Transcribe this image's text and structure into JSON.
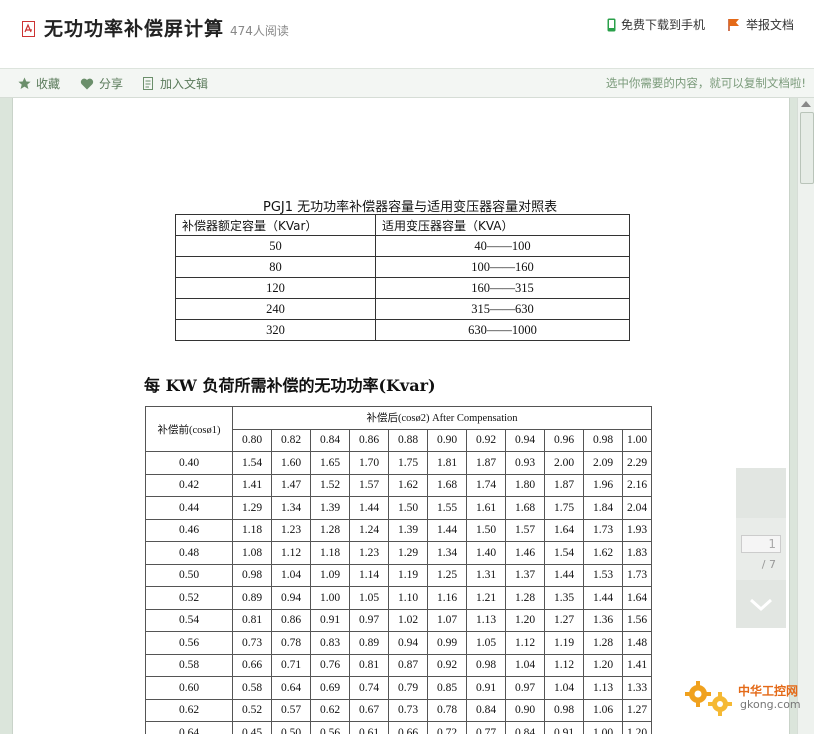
{
  "header": {
    "title": "无功功率补偿屏计算",
    "read_count": "474人阅读",
    "download_label": "免费下载到手机",
    "report_label": "举报文档"
  },
  "toolbar": {
    "favorite_label": "收藏",
    "share_label": "分享",
    "add_label": "加入文辑",
    "hint": "选中你需要的内容，就可以复制文档啦!"
  },
  "table1": {
    "caption": "PGJ1 无功功率补偿器容量与适用变压器容量对照表",
    "headers": [
      "补偿器额定容量（KVar）",
      "适用变压器容量（KVA）"
    ],
    "rows": [
      [
        "50",
        "40——100"
      ],
      [
        "80",
        "100——160"
      ],
      [
        "120",
        "160——315"
      ],
      [
        "240",
        "315——630"
      ],
      [
        "320",
        "630——1000"
      ]
    ]
  },
  "table2": {
    "heading": "每 KW 负荷所需补偿的无功功率(Kvar)",
    "row_header": "补偿前(cosø1)",
    "col_group_header": "补偿后(cosø2) After Compensation",
    "columns": [
      "0.80",
      "0.82",
      "0.84",
      "0.86",
      "0.88",
      "0.90",
      "0.92",
      "0.94",
      "0.96",
      "0.98",
      "1.00"
    ],
    "rows": [
      {
        "label": "0.40",
        "values": [
          "1.54",
          "1.60",
          "1.65",
          "1.70",
          "1.75",
          "1.81",
          "1.87",
          "0.93",
          "2.00",
          "2.09",
          "2.29"
        ]
      },
      {
        "label": "0.42",
        "values": [
          "1.41",
          "1.47",
          "1.52",
          "1.57",
          "1.62",
          "1.68",
          "1.74",
          "1.80",
          "1.87",
          "1.96",
          "2.16"
        ]
      },
      {
        "label": "0.44",
        "values": [
          "1.29",
          "1.34",
          "1.39",
          "1.44",
          "1.50",
          "1.55",
          "1.61",
          "1.68",
          "1.75",
          "1.84",
          "2.04"
        ]
      },
      {
        "label": "0.46",
        "values": [
          "1.18",
          "1.23",
          "1.28",
          "1.24",
          "1.39",
          "1.44",
          "1.50",
          "1.57",
          "1.64",
          "1.73",
          "1.93"
        ]
      },
      {
        "label": "0.48",
        "values": [
          "1.08",
          "1.12",
          "1.18",
          "1.23",
          "1.29",
          "1.34",
          "1.40",
          "1.46",
          "1.54",
          "1.62",
          "1.83"
        ]
      },
      {
        "label": "0.50",
        "values": [
          "0.98",
          "1.04",
          "1.09",
          "1.14",
          "1.19",
          "1.25",
          "1.31",
          "1.37",
          "1.44",
          "1.53",
          "1.73"
        ]
      },
      {
        "label": "0.52",
        "values": [
          "0.89",
          "0.94",
          "1.00",
          "1.05",
          "1.10",
          "1.16",
          "1.21",
          "1.28",
          "1.35",
          "1.44",
          "1.64"
        ]
      },
      {
        "label": "0.54",
        "values": [
          "0.81",
          "0.86",
          "0.91",
          "0.97",
          "1.02",
          "1.07",
          "1.13",
          "1.20",
          "1.27",
          "1.36",
          "1.56"
        ]
      },
      {
        "label": "0.56",
        "values": [
          "0.73",
          "0.78",
          "0.83",
          "0.89",
          "0.94",
          "0.99",
          "1.05",
          "1.12",
          "1.19",
          "1.28",
          "1.48"
        ]
      },
      {
        "label": "0.58",
        "values": [
          "0.66",
          "0.71",
          "0.76",
          "0.81",
          "0.87",
          "0.92",
          "0.98",
          "1.04",
          "1.12",
          "1.20",
          "1.41"
        ]
      },
      {
        "label": "0.60",
        "values": [
          "0.58",
          "0.64",
          "0.69",
          "0.74",
          "0.79",
          "0.85",
          "0.91",
          "0.97",
          "1.04",
          "1.13",
          "1.33"
        ]
      },
      {
        "label": "0.62",
        "values": [
          "0.52",
          "0.57",
          "0.62",
          "0.67",
          "0.73",
          "0.78",
          "0.84",
          "0.90",
          "0.98",
          "1.06",
          "1.27"
        ]
      },
      {
        "label": "0.64",
        "values": [
          "0.45",
          "0.50",
          "0.56",
          "0.61",
          "0.66",
          "0.72",
          "0.77",
          "0.84",
          "0.91",
          "1.00",
          "1.20"
        ]
      }
    ]
  },
  "pager": {
    "current_page": "1",
    "total_pages": "/ 7"
  },
  "watermark": {
    "text1": "中华工控网",
    "text2": "gkong.com"
  },
  "colors": {
    "accent_green": "#5a7a5a",
    "report_orange": "#e46a18"
  }
}
